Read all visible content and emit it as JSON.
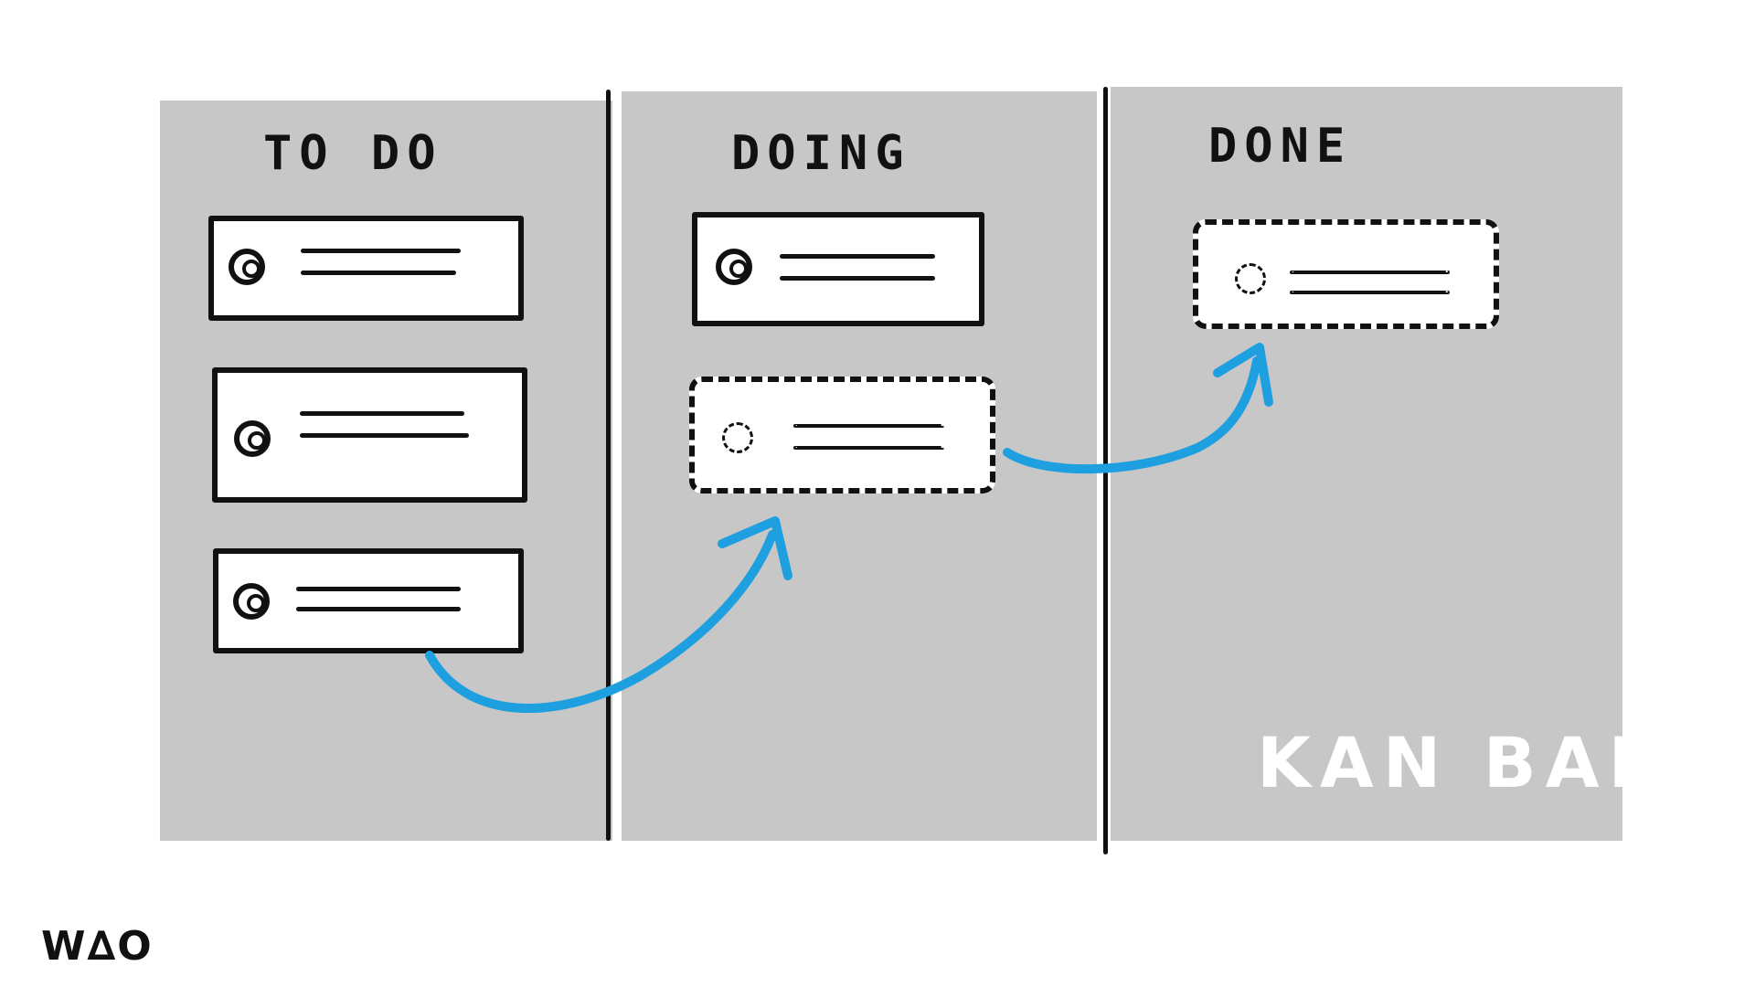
{
  "columns": [
    {
      "title": "TO DO"
    },
    {
      "title": "DOING"
    },
    {
      "title": "DONE"
    }
  ],
  "watermark": "KAN BAN",
  "logo": "W∆O",
  "colors": {
    "background": "#c8c7c8",
    "arrow": "#1e9fe0",
    "ink": "#111111"
  },
  "icons": [
    "avatar-icon",
    "arrow-icon"
  ]
}
